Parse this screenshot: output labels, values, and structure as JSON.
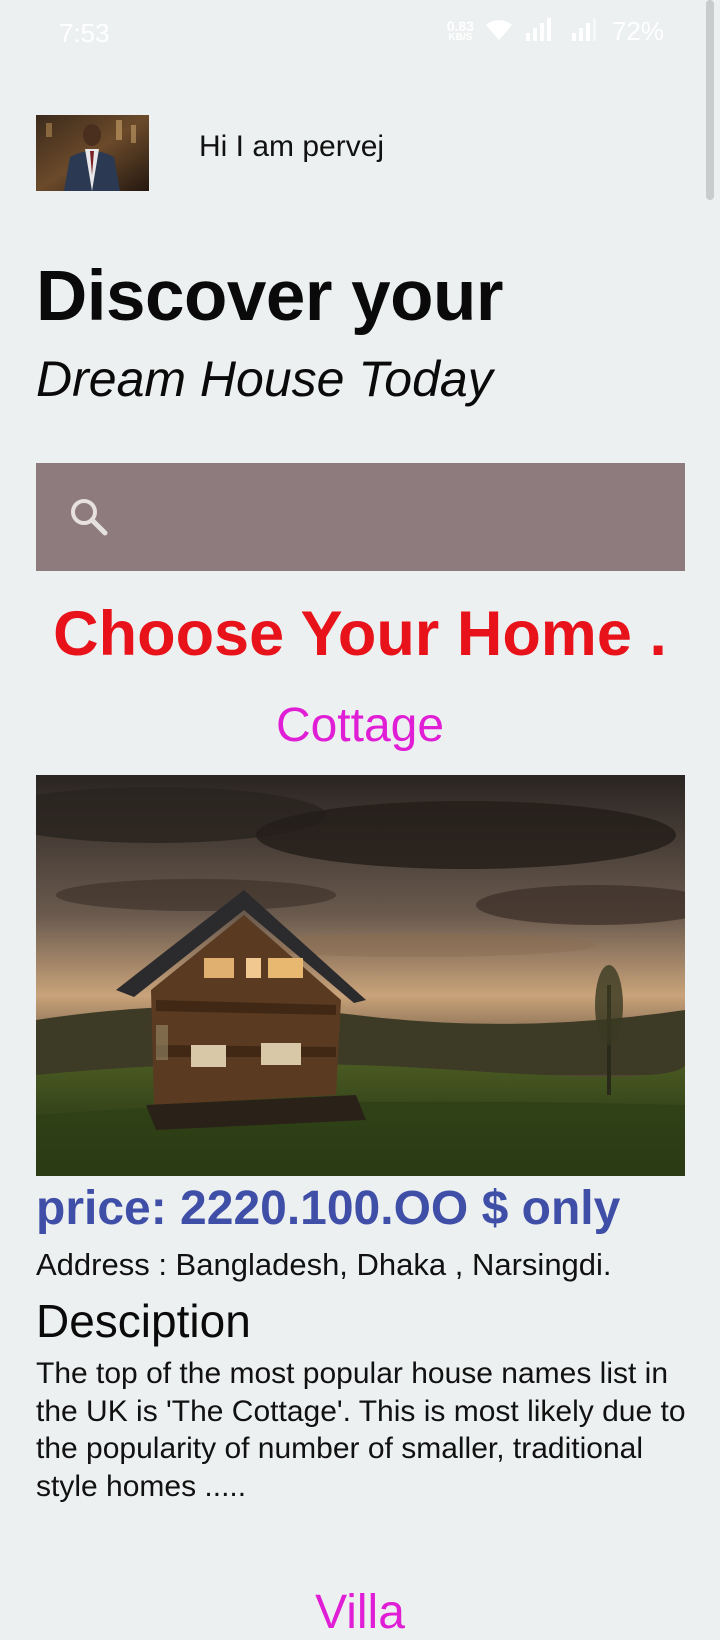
{
  "status_bar": {
    "time": "7:53",
    "net_speed_value": "0.83",
    "net_speed_unit": "KB/S",
    "battery": "72%"
  },
  "profile": {
    "greeting": "Hi I am pervej",
    "avatar_icon": "person-avatar"
  },
  "headline": {
    "line1": "Discover your",
    "line2": "Dream House Today"
  },
  "search": {
    "placeholder": "",
    "value": "",
    "icon": "search-icon",
    "background": "#8e7b7d"
  },
  "section_title": "Choose Your Home .",
  "listings": [
    {
      "category": "Cottage",
      "price": "price: 2220.100.OO $ only",
      "address": "Address : Bangladesh, Dhaka , Narsingdi.",
      "description_heading": "Desciption",
      "description": "The top of the most popular house names list in the UK is 'The Cottage'. This is most likely due to the popularity of number of smaller, traditional style homes ....."
    }
  ],
  "next_category": "Villa",
  "colors": {
    "background": "#edf0f0",
    "section_title": "#e8121a",
    "category": "#e01ed6",
    "price": "#3f4fa8"
  }
}
